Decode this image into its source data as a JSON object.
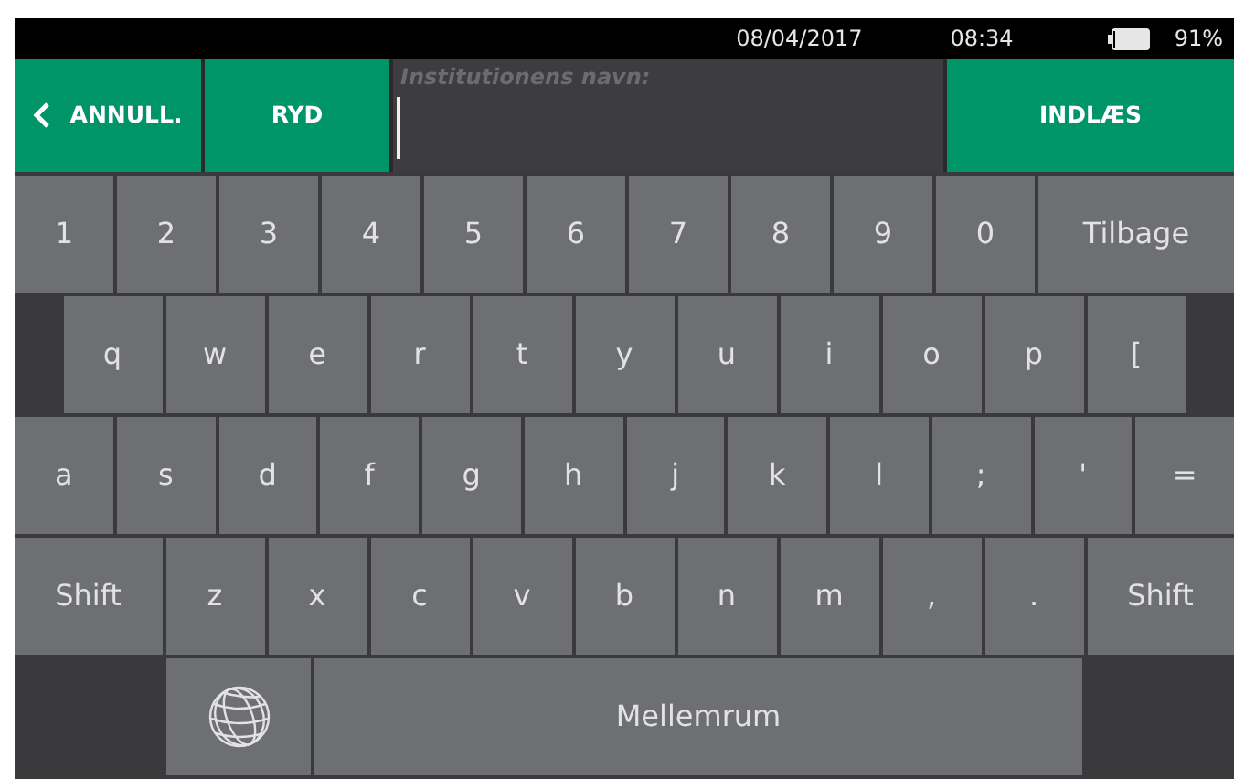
{
  "status_bar": {
    "date": "08/04/2017",
    "time": "08:34",
    "battery": "91%"
  },
  "top_bar": {
    "cancel_button": "ANNULL.",
    "clear_button": "RYD",
    "field": {
      "label": "Institutionens navn:"
    },
    "submit_button": "INDLÆS"
  },
  "keyboard": [
    {
      "keys": [
        {
          "kind": "char",
          "label": "1"
        },
        {
          "kind": "char",
          "label": "2"
        },
        {
          "kind": "char",
          "label": "3"
        },
        {
          "kind": "char",
          "label": "4"
        },
        {
          "kind": "char",
          "label": "5"
        },
        {
          "kind": "char",
          "label": "6"
        },
        {
          "kind": "char",
          "label": "7"
        },
        {
          "kind": "char",
          "label": "8"
        },
        {
          "kind": "char",
          "label": "9"
        },
        {
          "kind": "char",
          "label": "0"
        },
        {
          "kind": "wide",
          "label": "Tilbage"
        }
      ]
    },
    {
      "keys": [
        {
          "kind": "gap"
        },
        {
          "kind": "char",
          "label": "q"
        },
        {
          "kind": "char",
          "label": "w"
        },
        {
          "kind": "char",
          "label": "e"
        },
        {
          "kind": "char",
          "label": "r"
        },
        {
          "kind": "char",
          "label": "t"
        },
        {
          "kind": "char",
          "label": "y"
        },
        {
          "kind": "char",
          "label": "u"
        },
        {
          "kind": "char",
          "label": "i"
        },
        {
          "kind": "char",
          "label": "o"
        },
        {
          "kind": "char",
          "label": "p"
        },
        {
          "kind": "char",
          "label": "["
        },
        {
          "kind": "gap"
        }
      ]
    },
    {
      "keys": [
        {
          "kind": "char",
          "label": "a"
        },
        {
          "kind": "char",
          "label": "s"
        },
        {
          "kind": "char",
          "label": "d"
        },
        {
          "kind": "char",
          "label": "f"
        },
        {
          "kind": "char",
          "label": "g"
        },
        {
          "kind": "char",
          "label": "h"
        },
        {
          "kind": "char",
          "label": "j"
        },
        {
          "kind": "char",
          "label": "k"
        },
        {
          "kind": "char",
          "label": "l"
        },
        {
          "kind": "char",
          "label": ";"
        },
        {
          "kind": "char",
          "label": "'"
        },
        {
          "kind": "char",
          "label": "="
        }
      ]
    },
    {
      "keys": [
        {
          "kind": "wide",
          "label": "Shift"
        },
        {
          "kind": "char",
          "label": "z"
        },
        {
          "kind": "char",
          "label": "x"
        },
        {
          "kind": "char",
          "label": "c"
        },
        {
          "kind": "char",
          "label": "v"
        },
        {
          "kind": "char",
          "label": "b"
        },
        {
          "kind": "char",
          "label": "n"
        },
        {
          "kind": "char",
          "label": "m"
        },
        {
          "kind": "char",
          "label": ","
        },
        {
          "kind": "char",
          "label": "."
        },
        {
          "kind": "wide",
          "label": "Shift"
        }
      ]
    },
    {
      "keys": [
        {
          "kind": "gap"
        },
        {
          "kind": "globe"
        },
        {
          "kind": "space",
          "label": "Mellemrum"
        },
        {
          "kind": "gap"
        }
      ]
    }
  ]
}
